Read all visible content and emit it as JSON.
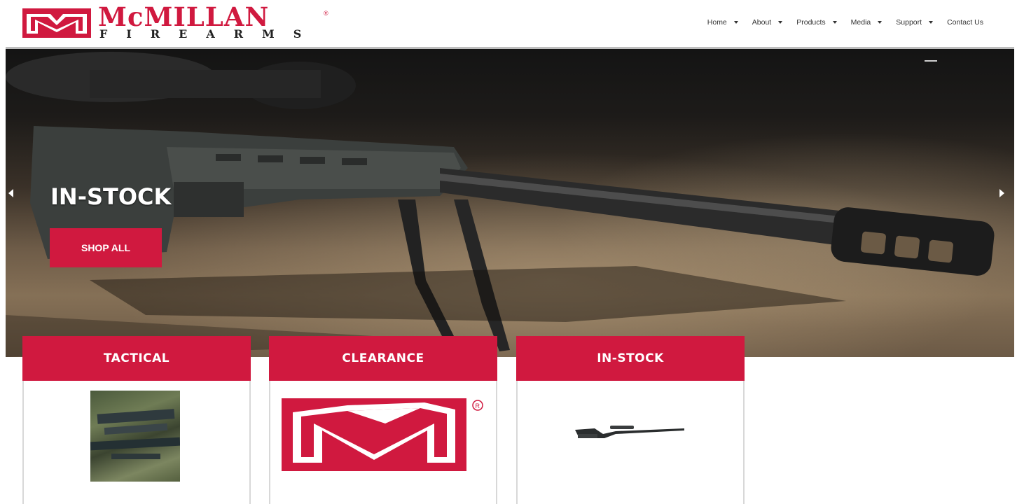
{
  "brand": {
    "wordmark": "McMILLAN",
    "registered": "®",
    "sub": "FIREARMS",
    "accent_color": "#d0193f"
  },
  "nav": {
    "items": [
      {
        "label": "Home",
        "dropdown": true
      },
      {
        "label": "About",
        "dropdown": true
      },
      {
        "label": "Products",
        "dropdown": true
      },
      {
        "label": "Media",
        "dropdown": true
      },
      {
        "label": "Support",
        "dropdown": true
      },
      {
        "label": "Contact Us",
        "dropdown": false
      }
    ]
  },
  "hero": {
    "title": "IN-STOCK",
    "button_label": "SHOP ALL",
    "prev_icon": "chevron-left-icon",
    "next_icon": "chevron-right-icon"
  },
  "cards": [
    {
      "title": "TACTICAL",
      "image": "tactical-rifle-photo"
    },
    {
      "title": "CLEARANCE",
      "image": "mcmillan-logo-mark"
    },
    {
      "title": "IN-STOCK",
      "image": "rifle-photo"
    }
  ]
}
